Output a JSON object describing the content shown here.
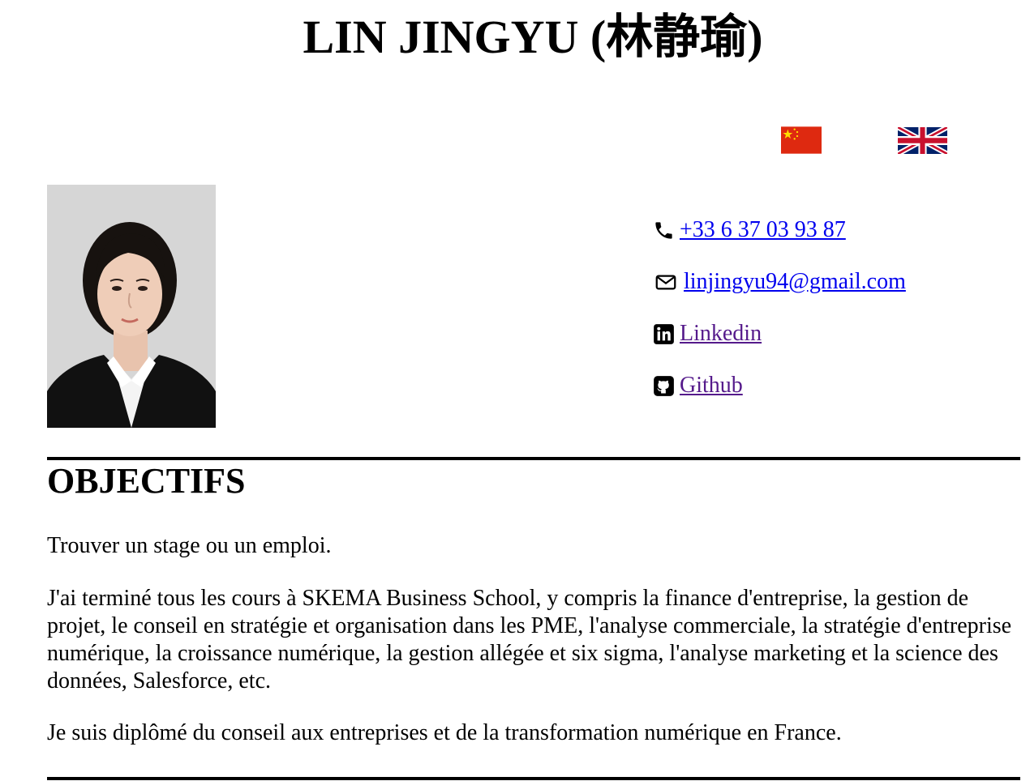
{
  "header": {
    "title": "LIN JINGYU (林静瑜)"
  },
  "languages": [
    {
      "name": "chinese-flag",
      "colors": {
        "field": "#de2910",
        "stars": "#ffde00"
      }
    },
    {
      "name": "uk-flag",
      "colors": {
        "blue": "#012169",
        "red": "#c8102e",
        "white": "#ffffff"
      }
    }
  ],
  "profile": {
    "photo_background": "#d6d6d6"
  },
  "contacts": {
    "phone": {
      "icon": "phone-icon",
      "text": "+33 6 37 03 93 87"
    },
    "email": {
      "icon": "envelope-icon",
      "text": "linjingyu94@gmail.com"
    },
    "linkedin": {
      "icon": "linkedin-icon",
      "text": "Linkedin"
    },
    "github": {
      "icon": "github-icon",
      "text": "Github"
    }
  },
  "objectives": {
    "heading": "OBJECTIFS",
    "paragraphs": [
      "Trouver un stage ou un emploi.",
      "J'ai terminé tous les cours à SKEMA Business School, y compris la finance d'entreprise, la gestion de projet, le conseil en stratégie et organisation dans les PME, l'analyse commerciale, la stratégie d'entreprise numérique, la croissance numérique, la gestion allégée et six sigma, l'analyse marketing et la science des données, Salesforce, etc.",
      "Je suis diplômé du conseil aux entreprises et de la transformation numérique en France."
    ]
  },
  "colors": {
    "link": "#0000ee",
    "visited_link": "#551a8b",
    "text": "#000000"
  }
}
